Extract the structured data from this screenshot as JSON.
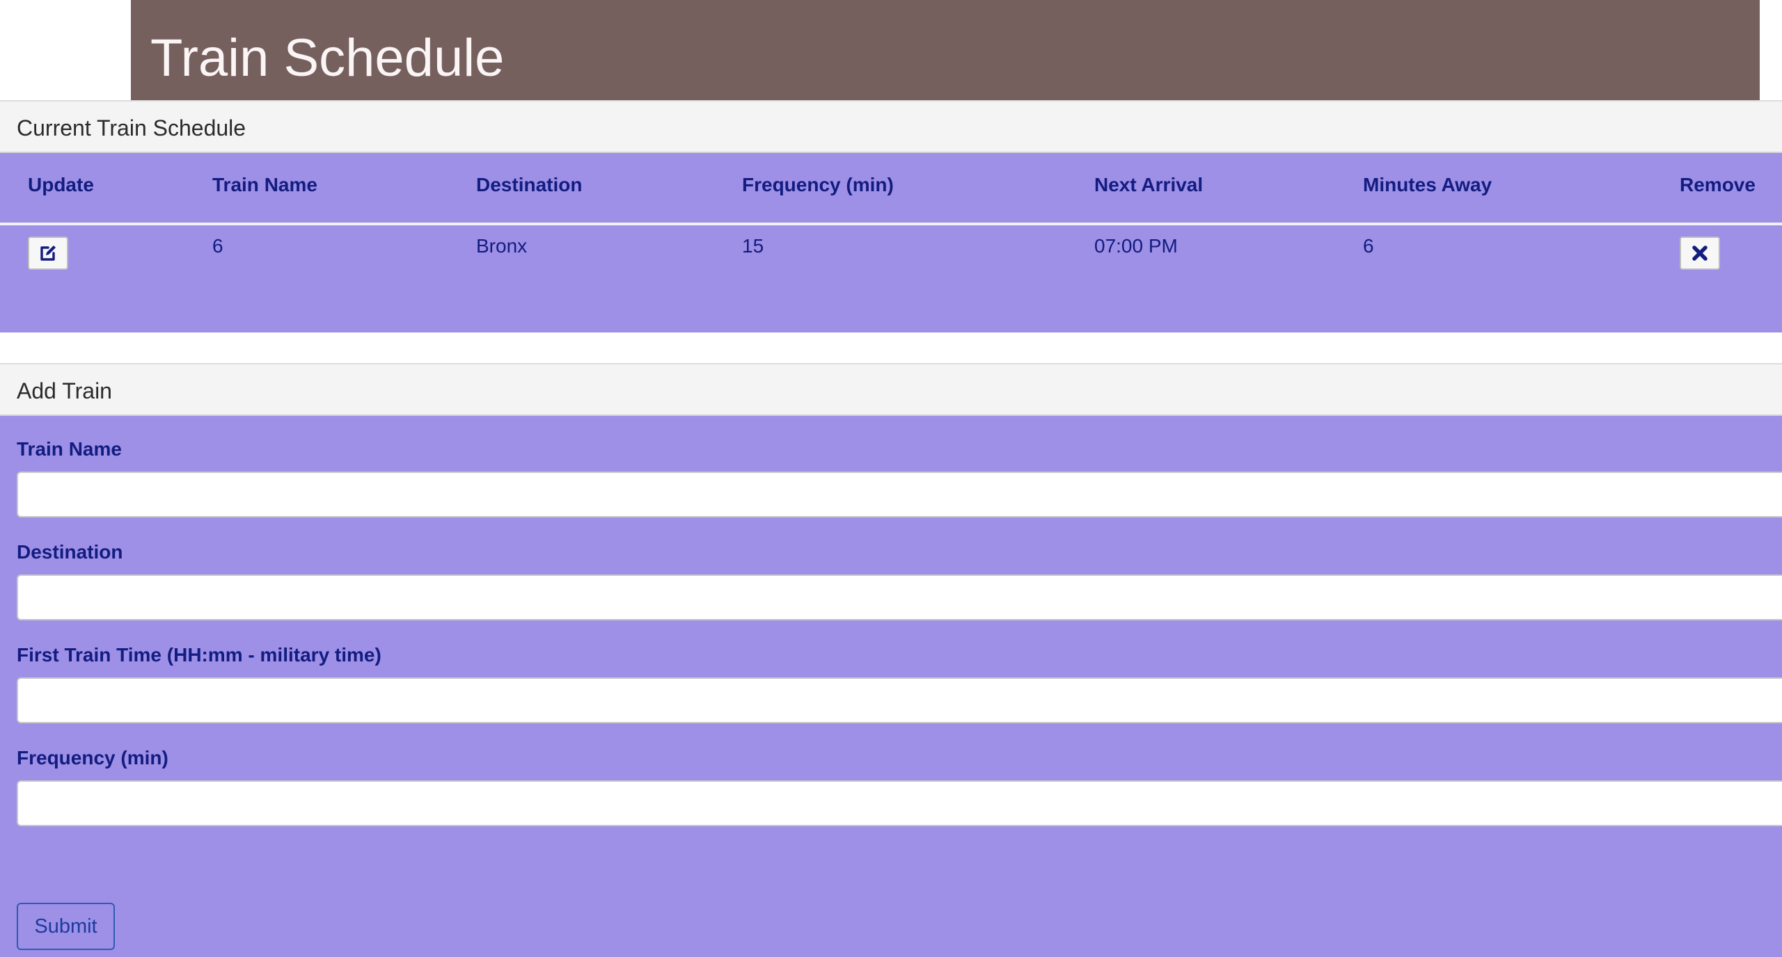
{
  "header": {
    "title": "Train Schedule"
  },
  "schedule": {
    "heading": "Current Train Schedule",
    "columns": [
      "Update",
      "Train Name",
      "Destination",
      "Frequency (min)",
      "Next Arrival",
      "Minutes Away",
      "Remove"
    ],
    "rows": [
      {
        "train_name": "6",
        "destination": "Bronx",
        "frequency": "15",
        "next_arrival": "07:00 PM",
        "minutes_away": "6"
      }
    ],
    "update_icon": "edit-icon",
    "remove_icon": "close-icon"
  },
  "add_train": {
    "heading": "Add Train",
    "fields": {
      "train_name": {
        "label": "Train Name",
        "value": "",
        "placeholder": ""
      },
      "destination": {
        "label": "Destination",
        "value": "",
        "placeholder": ""
      },
      "first_train_time": {
        "label": "First Train Time (HH:mm - military time)",
        "value": "",
        "placeholder": ""
      },
      "frequency": {
        "label": "Frequency (min)",
        "value": "",
        "placeholder": ""
      }
    },
    "submit_label": "Submit"
  },
  "colors": {
    "jumbotron_bg": "#75605e",
    "panel_body_bg": "#9d90e6",
    "text_accent": "#131c80",
    "heading_bg": "#f4f4f4"
  }
}
